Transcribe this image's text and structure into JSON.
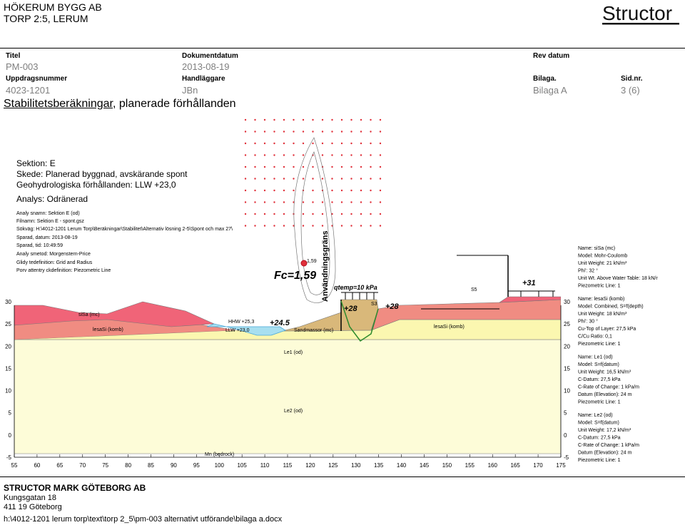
{
  "header": {
    "company_line1": "HÖKERUM BYGG AB",
    "company_line2": "TORP 2:5, LERUM",
    "logo_text": "Structor",
    "fields": [
      {
        "label": "Titel",
        "value": "PM-003"
      },
      {
        "label": "Dokumentdatum",
        "value": "2013-08-19"
      },
      {
        "label": "Rev datum",
        "value": ""
      },
      {
        "label": "Uppdragsnummer",
        "value": "4023-1201"
      },
      {
        "label": "Handläggare",
        "value": "JBn"
      },
      {
        "label": "Bilaga.",
        "value": "Bilaga A"
      },
      {
        "label": "Sid.nr.",
        "value": "3 (6)"
      }
    ]
  },
  "page_title": {
    "part1": "Stabilitetsberäkningar",
    "part2": ", planerade förhållanden"
  },
  "section": {
    "title": "Sektion: E",
    "stage": "Skede: Planerad byggnad, avskärande spont",
    "hydro": "Geohydrologiska förhållanden: LLW +23,0",
    "analysis": "Analys: Odränerad"
  },
  "analysis_meta": [
    "Analy snamn: Sektion E (od)",
    "Filnamn: Sektion E - spont.gsz",
    "Sökväg: H:\\4012-1201 Lerum Torp\\Beräkningar\\Stabilitet\\Alternativ lösning 2-5\\Spont och max 27\\",
    "Sparad, datum: 2013-08-19",
    "Sparad, tid: 10:49:59",
    "Analy smetod: Morgenstern-Price",
    "Glidy tedefinition: Grid and Radius",
    "Porv attentry ckdefinition: Piezometric Line"
  ],
  "diagram_labels": {
    "fc": "Fc=1,59",
    "fc_small": "1,59",
    "anvandningsgrans": "Användningsgräns",
    "qtemp": "qtemp=10 kPa",
    "hhw": "HHW +25,3",
    "llw": "LLW +23,0",
    "level_245": "+24.5",
    "level_28a": "+28",
    "level_28b": "+28",
    "level_31": "+31",
    "s3": "S3",
    "s5": "S5",
    "sisa": "siSa (mc)",
    "lesasi_left": "lesaSi (komb)",
    "lesasi_right": "lesaSi (komb)",
    "sandmassor": "Sandmassor (mc)",
    "le1": "Le1 (od)",
    "le2": "Le2 (od)",
    "mn": "Mn (bedrock)"
  },
  "axis": {
    "x_ticks": [
      "55",
      "60",
      "65",
      "70",
      "75",
      "80",
      "85",
      "90",
      "95",
      "100",
      "105",
      "110",
      "115",
      "120",
      "125",
      "130",
      "135",
      "140",
      "145",
      "150",
      "155",
      "160",
      "165",
      "170",
      "175"
    ],
    "y_ticks": [
      "30",
      "25",
      "20",
      "15",
      "10",
      "5",
      "0",
      "-5"
    ]
  },
  "materials": [
    {
      "name": "Name: siSa (mc)",
      "lines": [
        "Model: Mohr-Coulomb",
        "Unit Weight: 21 kN/m³",
        "Phi': 32 °",
        "Unit Wt. Above Water Table: 18 kN/r",
        "Piezometric Line: 1"
      ]
    },
    {
      "name": "Name: lesaSi (komb)",
      "lines": [
        "Model: Combined, S=f(depth)",
        "Unit Weight: 18 kN/m³",
        "Phi': 30 °",
        "Cu-Top of Layer: 27,5 kPa",
        "C/Cu Ratio: 0,1",
        "Piezometric Line: 1"
      ]
    },
    {
      "name": "Name: Le1 (od)",
      "lines": [
        "Model: S=f(datum)",
        "Unit Weight: 16,5 kN/m³",
        "C-Datum: 27,5 kPa",
        "C-Rate of Change: 1 kPa/m",
        "Datum (Elevation): 24 m",
        "Piezometric Line: 1"
      ]
    },
    {
      "name": "Name: Le2 (od)",
      "lines": [
        "Model: S=f(datum)",
        "Unit Weight: 17,2 kN/m³",
        "C-Datum: 27,5 kPa",
        "C-Rate of Change: 1 kPa/m",
        "Datum (Elevation): 24 m",
        "Piezometric Line: 1"
      ]
    }
  ],
  "footer": {
    "company": "STRUCTOR MARK GÖTEBORG AB",
    "street": "Kungsgatan 18",
    "city": "411 19 Göteborg",
    "path": "h:\\4012-1201 lerum torp\\text\\torp 2_5\\pm-003 alternativt utförande\\bilaga a.docx"
  },
  "colors": {
    "sisa": "#f06478",
    "lesasi": "#f08c82",
    "le1": "#fbf7b0",
    "le2": "#fdfcd8",
    "sand": "#d9b87a",
    "water": "#a8dff0",
    "grid_dots": "#e0303a",
    "slip_surface": "#2d8a2d",
    "critical_center": "#e0303a"
  }
}
